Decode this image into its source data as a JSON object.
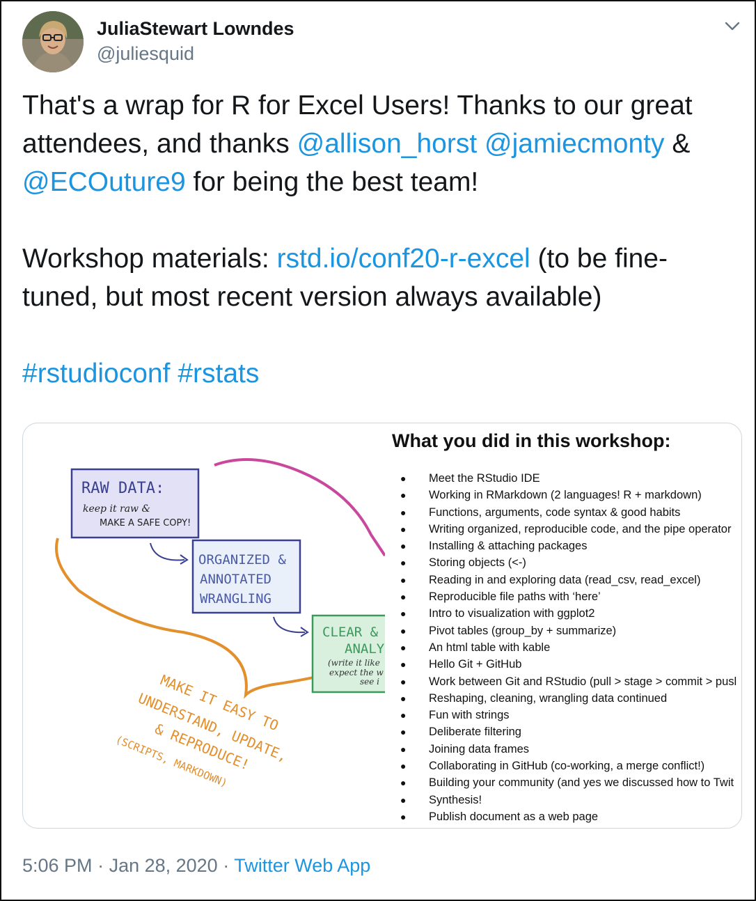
{
  "author": {
    "display_name": "JuliaStewart Lowndes",
    "handle": "@juliesquid"
  },
  "tweet": {
    "line1": "That's a wrap for R for Excel Users! Thanks to our great attendees, and thanks ",
    "mention1": "@allison_horst",
    "sep1": " ",
    "mention2": "@jamiecmonty",
    "amp": " & ",
    "mention3": "@ECOuture9",
    "line1_end": " for being the best team!",
    "materials_label": "Workshop materials: ",
    "materials_link": "rstd.io/conf20-r-excel",
    "materials_end": " (to be fine-tuned, but most recent version always available)",
    "hashtag1": "#rstudioconf",
    "hashtag2": "#rstats"
  },
  "card": {
    "title": "What you did in this workshop:",
    "illustration": {
      "raw_data": "RAW DATA:",
      "keep_raw": "keep it raw &",
      "safe_copy": "MAKE A SAFE COPY!",
      "organized": "ORGANIZED &",
      "annotated": "ANNOTATED",
      "wrangling": "WRANGLING",
      "clear": "CLEAR &",
      "analy": "ANALY",
      "write_like": "(write it like",
      "expect_the": "expect the w",
      "see": "see i",
      "make_easy": "MAKE IT EASY TO",
      "understand": "UNDERSTAND, UPDATE,",
      "reproduce": "& REPRODUCE!",
      "scripts": "(SCRIPTS, MARKDOWN)"
    },
    "items": [
      "Meet the RStudio IDE",
      "Working in RMarkdown (2 languages! R + markdown)",
      "Functions, arguments, code syntax & good habits",
      "Writing organized, reproducible code, and the pipe operator",
      "Installing & attaching packages",
      "Storing objects (<-)",
      "Reading in and exploring data (read_csv, read_excel)",
      "Reproducible file paths with ‘here’",
      "Intro to visualization with ggplot2",
      "Pivot tables (group_by + summarize)",
      "An html table with kable",
      "Hello Git + GitHub",
      "Work between Git and RStudio (pull > stage > commit > pusl",
      "Reshaping, cleaning, wrangling data continued",
      "Fun with strings",
      "Deliberate filtering",
      "Joining data frames",
      "Collaborating in GitHub (co-working, a merge conflict!)",
      "Building your community (and yes we discussed how to Twit",
      "Synthesis!",
      "Publish document as a web page"
    ]
  },
  "meta": {
    "time": "5:06 PM",
    "dot1": " · ",
    "date": "Jan 28, 2020",
    "dot2": " · ",
    "source": "Twitter Web App"
  },
  "icons": {
    "caret": "chevron-down-icon"
  },
  "colors": {
    "link": "#1b95e0",
    "muted": "#657786",
    "text": "#14171a",
    "pink": "#c9479c",
    "orange": "#e28f2c"
  }
}
